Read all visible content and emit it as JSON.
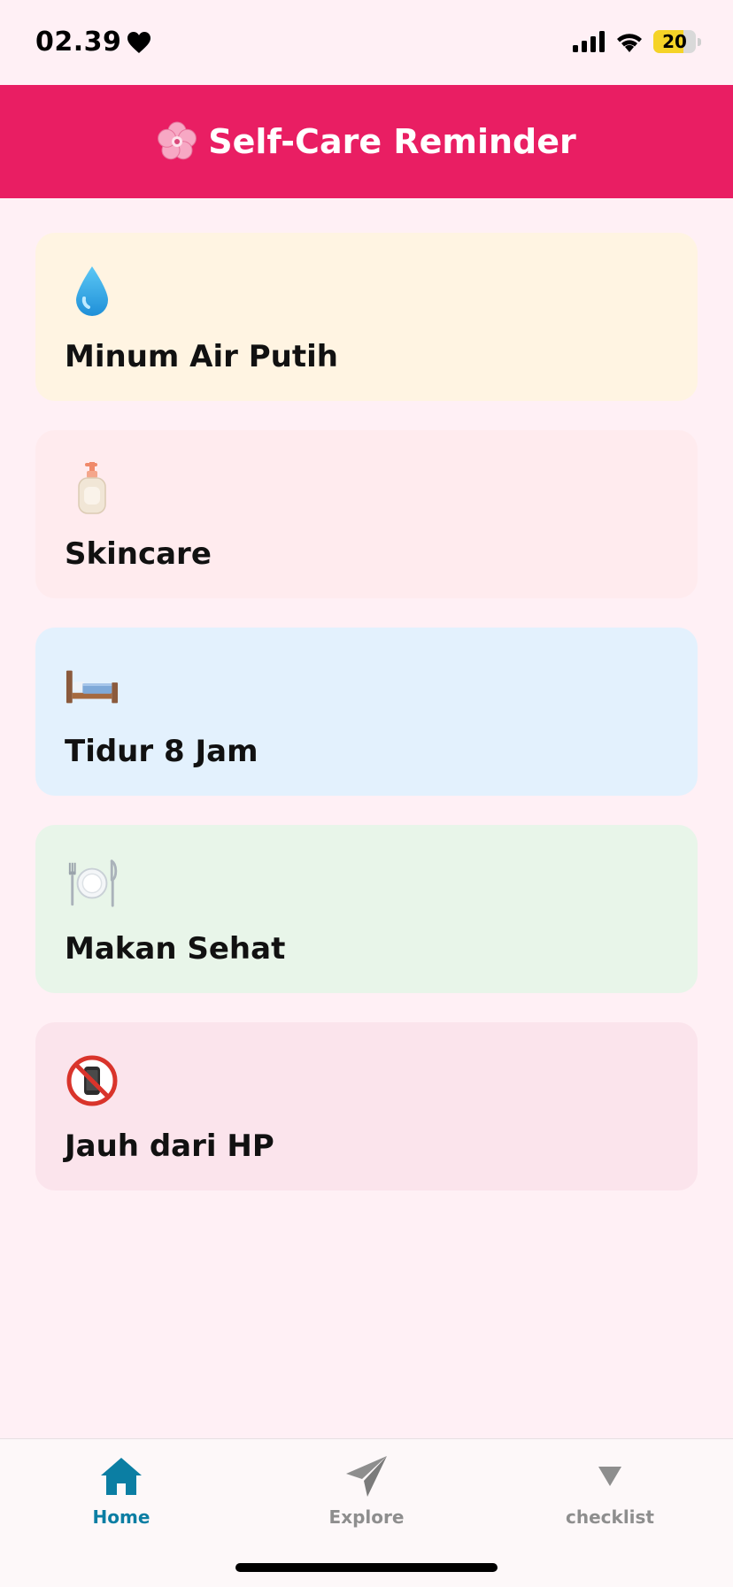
{
  "status_bar": {
    "time": "02.39",
    "battery": {
      "text": "20",
      "level": 0.2,
      "fill_color": "#f5d327"
    }
  },
  "header": {
    "title": "Self-Care Reminder",
    "icon": "cherry-blossom-icon",
    "background": "#e91e63"
  },
  "cards": [
    {
      "label": "Minum Air Putih",
      "icon": "water-droplet-icon",
      "background": "#fff4e2"
    },
    {
      "label": "Skincare",
      "icon": "lotion-bottle-icon",
      "background": "#ffebee"
    },
    {
      "label": "Tidur 8 Jam",
      "icon": "bed-icon",
      "background": "#e3f1fd"
    },
    {
      "label": "Makan Sehat",
      "icon": "plate-cutlery-icon",
      "background": "#e8f5e9"
    },
    {
      "label": "Jauh dari HP",
      "icon": "no-phone-icon",
      "background": "#fbe4ec"
    }
  ],
  "bottom_nav": {
    "items": [
      {
        "label": "Home",
        "icon": "home-icon",
        "active": true,
        "color": "#0b7ea3"
      },
      {
        "label": "Explore",
        "icon": "send-icon",
        "active": false,
        "color": "#8e8e8e"
      },
      {
        "label": "checklist",
        "icon": "triangle-down-icon",
        "active": false,
        "color": "#8e8e8e"
      }
    ]
  }
}
